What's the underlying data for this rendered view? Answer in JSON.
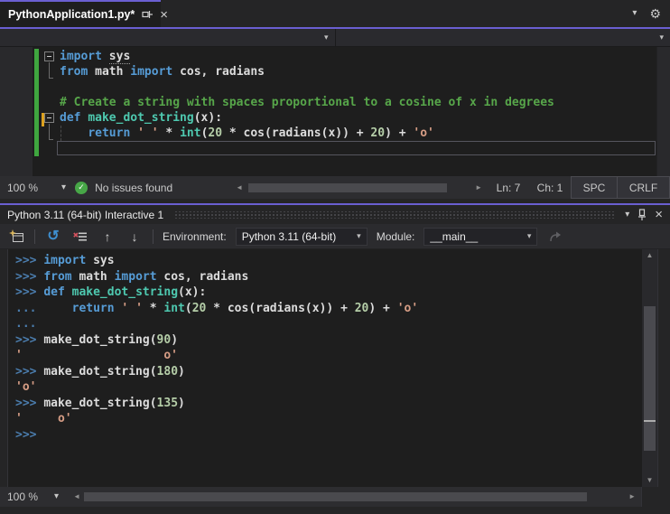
{
  "colors": {
    "accent_purple": "#6A5FD1",
    "keyword_blue": "#569CD6",
    "function_teal": "#4EC9B0",
    "string_orange": "#D69D85",
    "number_green": "#B5CEA8",
    "comment_green": "#57A64A",
    "change_bar_green": "#3FA63F",
    "unsaved_bar_yellow": "#DCA11F",
    "check_green": "#47A647"
  },
  "icons": {
    "chevron_down": "▾",
    "gear": "⚙",
    "close": "×",
    "check": "✓",
    "reset": "↺",
    "history_up": "↑",
    "history_down": "↓",
    "scroll_left": "◄",
    "scroll_right": "►",
    "scroll_up": "▲",
    "scroll_down": "▼"
  },
  "tab": {
    "title": "PythonApplication1.py*"
  },
  "editor": {
    "current_line": 7,
    "lines": [
      [
        {
          "t": "import ",
          "c": "kw"
        },
        {
          "t": "sys",
          "c": "und"
        }
      ],
      [
        {
          "t": "from ",
          "c": "kw"
        },
        {
          "t": "math ",
          "c": "txt"
        },
        {
          "t": "import ",
          "c": "kw"
        },
        {
          "t": "cos, radians",
          "c": "txt"
        }
      ],
      [],
      [
        {
          "t": "# Create a string with spaces proportional to a cosine of x in degrees",
          "c": "com"
        }
      ],
      [
        {
          "t": "def ",
          "c": "kw"
        },
        {
          "t": "make_dot_string",
          "c": "fn"
        },
        {
          "t": "(x):",
          "c": "txt"
        }
      ],
      [
        {
          "t": "    ",
          "c": "txt"
        },
        {
          "t": "return ",
          "c": "kw"
        },
        {
          "t": "' '",
          "c": "str"
        },
        {
          "t": " * ",
          "c": "txt"
        },
        {
          "t": "int",
          "c": "fn"
        },
        {
          "t": "(",
          "c": "txt"
        },
        {
          "t": "20",
          "c": "num"
        },
        {
          "t": " * cos(radians(x)) + ",
          "c": "txt"
        },
        {
          "t": "20",
          "c": "num"
        },
        {
          "t": ") + ",
          "c": "txt"
        },
        {
          "t": "'o'",
          "c": "str"
        }
      ],
      []
    ]
  },
  "editor_status": {
    "zoom": "100 %",
    "message": "No issues found",
    "line": "Ln: 7",
    "column": "Ch: 1",
    "spaces": "SPC",
    "line_ending": "CRLF"
  },
  "interactive": {
    "title": "Python 3.11 (64-bit) Interactive 1",
    "toolbar": {
      "environment_label": "Environment:",
      "environment_value": "Python 3.11 (64-bit)",
      "module_label": "Module:",
      "module_value": "__main__"
    },
    "lines": [
      [
        {
          "t": ">>> ",
          "c": "pr"
        },
        {
          "t": "import ",
          "c": "kw"
        },
        {
          "t": "sys",
          "c": "txt"
        }
      ],
      [
        {
          "t": ">>> ",
          "c": "pr"
        },
        {
          "t": "from ",
          "c": "kw"
        },
        {
          "t": "math ",
          "c": "txt"
        },
        {
          "t": "import ",
          "c": "kw"
        },
        {
          "t": "cos, radians",
          "c": "txt"
        }
      ],
      [
        {
          "t": ">>> ",
          "c": "pr"
        },
        {
          "t": "def ",
          "c": "kw"
        },
        {
          "t": "make_dot_string",
          "c": "fn"
        },
        {
          "t": "(x):",
          "c": "txt"
        }
      ],
      [
        {
          "t": "... ",
          "c": "pr"
        },
        {
          "t": "    ",
          "c": "txt"
        },
        {
          "t": "return ",
          "c": "kw"
        },
        {
          "t": "' '",
          "c": "str"
        },
        {
          "t": " * ",
          "c": "txt"
        },
        {
          "t": "int",
          "c": "fn"
        },
        {
          "t": "(",
          "c": "txt"
        },
        {
          "t": "20",
          "c": "num"
        },
        {
          "t": " * cos(radians(x)) + ",
          "c": "txt"
        },
        {
          "t": "20",
          "c": "num"
        },
        {
          "t": ") + ",
          "c": "txt"
        },
        {
          "t": "'o'",
          "c": "str"
        }
      ],
      [
        {
          "t": "...",
          "c": "pr"
        }
      ],
      [
        {
          "t": ">>> ",
          "c": "pr"
        },
        {
          "t": "make_dot_string(",
          "c": "txt"
        },
        {
          "t": "90",
          "c": "num"
        },
        {
          "t": ")",
          "c": "txt"
        }
      ],
      [
        {
          "t": "'                    o'",
          "c": "str"
        }
      ],
      [
        {
          "t": ">>> ",
          "c": "pr"
        },
        {
          "t": "make_dot_string(",
          "c": "txt"
        },
        {
          "t": "180",
          "c": "num"
        },
        {
          "t": ")",
          "c": "txt"
        }
      ],
      [
        {
          "t": "'o'",
          "c": "str"
        }
      ],
      [
        {
          "t": ">>> ",
          "c": "pr"
        },
        {
          "t": "make_dot_string(",
          "c": "txt"
        },
        {
          "t": "135",
          "c": "num"
        },
        {
          "t": ")",
          "c": "txt"
        }
      ],
      [
        {
          "t": "'     o'",
          "c": "str"
        }
      ],
      [
        {
          "t": ">>>",
          "c": "pr"
        }
      ]
    ],
    "status": {
      "zoom": "100 %"
    }
  }
}
